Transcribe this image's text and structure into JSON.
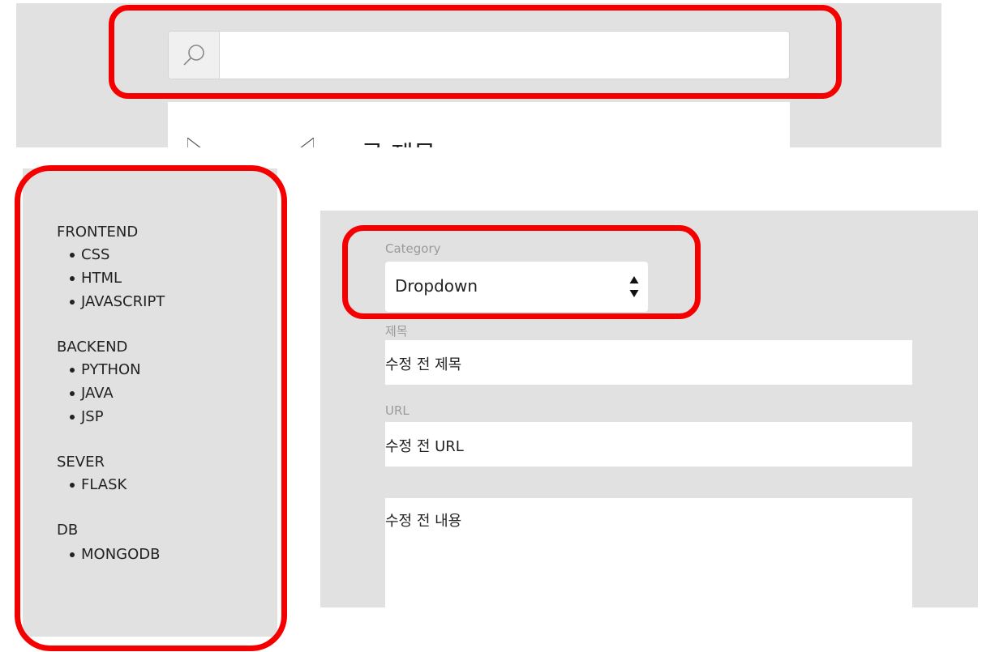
{
  "search": {
    "placeholder": "",
    "value": ""
  },
  "content_card": {
    "title": "글 제목"
  },
  "sidebar": {
    "groups": [
      {
        "title": "FRONTEND",
        "items": [
          "CSS",
          "HTML",
          "JAVASCRIPT"
        ]
      },
      {
        "title": "BACKEND",
        "items": [
          "PYTHON",
          "JAVA",
          "JSP"
        ]
      },
      {
        "title": "SEVER",
        "items": [
          "FLASK"
        ]
      },
      {
        "title": "DB",
        "items": [
          "MONGODB"
        ]
      }
    ]
  },
  "form": {
    "category_label": "Category",
    "category_value": "Dropdown",
    "title_label": "제목",
    "title_value": "수정 전 제목",
    "url_label": "URL",
    "url_value": "수정 전 URL",
    "content_value": "수정 전 내용"
  },
  "colors": {
    "highlight": "#f50000",
    "panel_bg": "#e1e1e1"
  },
  "icons": [
    "search-icon",
    "image-placeholder-icon",
    "select-arrows-icon"
  ]
}
